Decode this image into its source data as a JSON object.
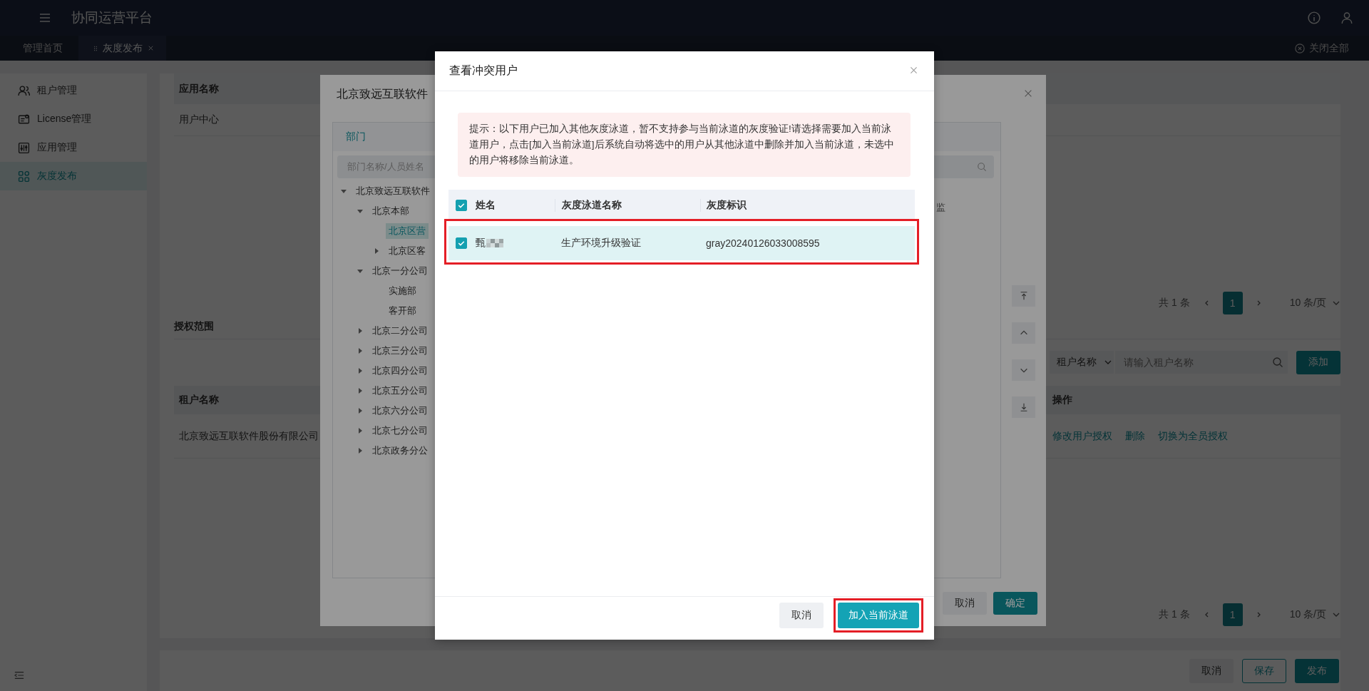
{
  "header": {
    "title": "协同运营平台"
  },
  "tabs": [
    {
      "label": "管理首页",
      "selected": false,
      "closable": false
    },
    {
      "label": "灰度发布",
      "selected": true,
      "closable": true
    }
  ],
  "close_all": "关闭全部",
  "sidebar": {
    "items": [
      {
        "label": "租户管理",
        "selected": false
      },
      {
        "label": "License管理",
        "selected": false
      },
      {
        "label": "应用管理",
        "selected": false
      },
      {
        "label": "灰度发布",
        "selected": true
      }
    ]
  },
  "app_table": {
    "columns": [
      "应用名称"
    ],
    "rows": [
      [
        "用户中心"
      ]
    ],
    "pagination": {
      "total": "共 1 条",
      "pages": [
        {
          "label": "1",
          "selected": true
        }
      ],
      "page_size": "10 条/页"
    }
  },
  "auth_scope": {
    "title": "授权范围",
    "filter_field": "租户名称",
    "filter_placeholder": "请输入租户名称",
    "add_button": "添加",
    "columns": [
      "租户名称",
      "操作"
    ],
    "rows": [
      {
        "name": "北京致远互联软件股份有限公司",
        "actions": [
          "修改用户授权",
          "删除",
          "切换为全员授权"
        ]
      }
    ],
    "pagination": {
      "total": "共 1 条",
      "pages": [
        {
          "label": "1",
          "selected": true
        }
      ],
      "page_size": "10 条/页"
    }
  },
  "footer_buttons": [
    {
      "label": "取消",
      "kind": "plain"
    },
    {
      "label": "保存",
      "kind": "outline"
    },
    {
      "label": "发布",
      "kind": "primary"
    }
  ],
  "select_dialog": {
    "title": "北京致远互联软件",
    "tab": "部门",
    "search_placeholder": "部门名称/人员姓名",
    "partial_text": "监",
    "tree": [
      {
        "label": "北京致远互联软件",
        "kind": "branch",
        "expanded": true,
        "selected": false,
        "children": [
          {
            "label": "北京本部",
            "kind": "branch",
            "expanded": true,
            "selected": false,
            "children": [
              {
                "label": "北京区营",
                "kind": "leaf",
                "selected": true
              },
              {
                "label": "北京区客",
                "kind": "branch",
                "expanded": false,
                "selected": false
              }
            ]
          },
          {
            "label": "北京一分公司",
            "kind": "branch",
            "expanded": true,
            "selected": false,
            "children": [
              {
                "label": "实施部",
                "kind": "leaf",
                "selected": false
              },
              {
                "label": "客开部",
                "kind": "leaf",
                "selected": false
              }
            ]
          },
          {
            "label": "北京二分公司",
            "kind": "branch",
            "expanded": false,
            "selected": false
          },
          {
            "label": "北京三分公司",
            "kind": "branch",
            "expanded": false,
            "selected": false
          },
          {
            "label": "北京四分公司",
            "kind": "branch",
            "expanded": false,
            "selected": false
          },
          {
            "label": "北京五分公司",
            "kind": "branch",
            "expanded": false,
            "selected": false
          },
          {
            "label": "北京六分公司",
            "kind": "branch",
            "expanded": false,
            "selected": false
          },
          {
            "label": "北京七分公司",
            "kind": "branch",
            "expanded": false,
            "selected": false
          },
          {
            "label": "北京政务分公",
            "kind": "branch",
            "expanded": false,
            "selected": false
          }
        ]
      }
    ],
    "buttons": [
      {
        "label": "取消",
        "kind": "plain"
      },
      {
        "label": "确定",
        "kind": "primary"
      }
    ]
  },
  "conflict_dialog": {
    "title": "查看冲突用户",
    "notice": "提示：以下用户已加入其他灰度泳道，暂不支持参与当前泳道的灰度验证!请选择需要加入当前泳道用户，点击[加入当前泳道]后系统自动将选中的用户从其他泳道中删除并加入当前泳道，未选中的用户将移除当前泳道。",
    "all_checked": true,
    "columns": [
      "姓名",
      "灰度泳道名称",
      "灰度标识"
    ],
    "rows": [
      {
        "name": "甄",
        "lane": "生产环境升级验证",
        "tag": "gray20240126033008595",
        "checked": true,
        "highlighted": true
      }
    ],
    "buttons": [
      {
        "label": "取消",
        "kind": "plain",
        "highlighted": false
      },
      {
        "label": "加入当前泳道",
        "kind": "primary",
        "highlighted": true
      }
    ]
  }
}
